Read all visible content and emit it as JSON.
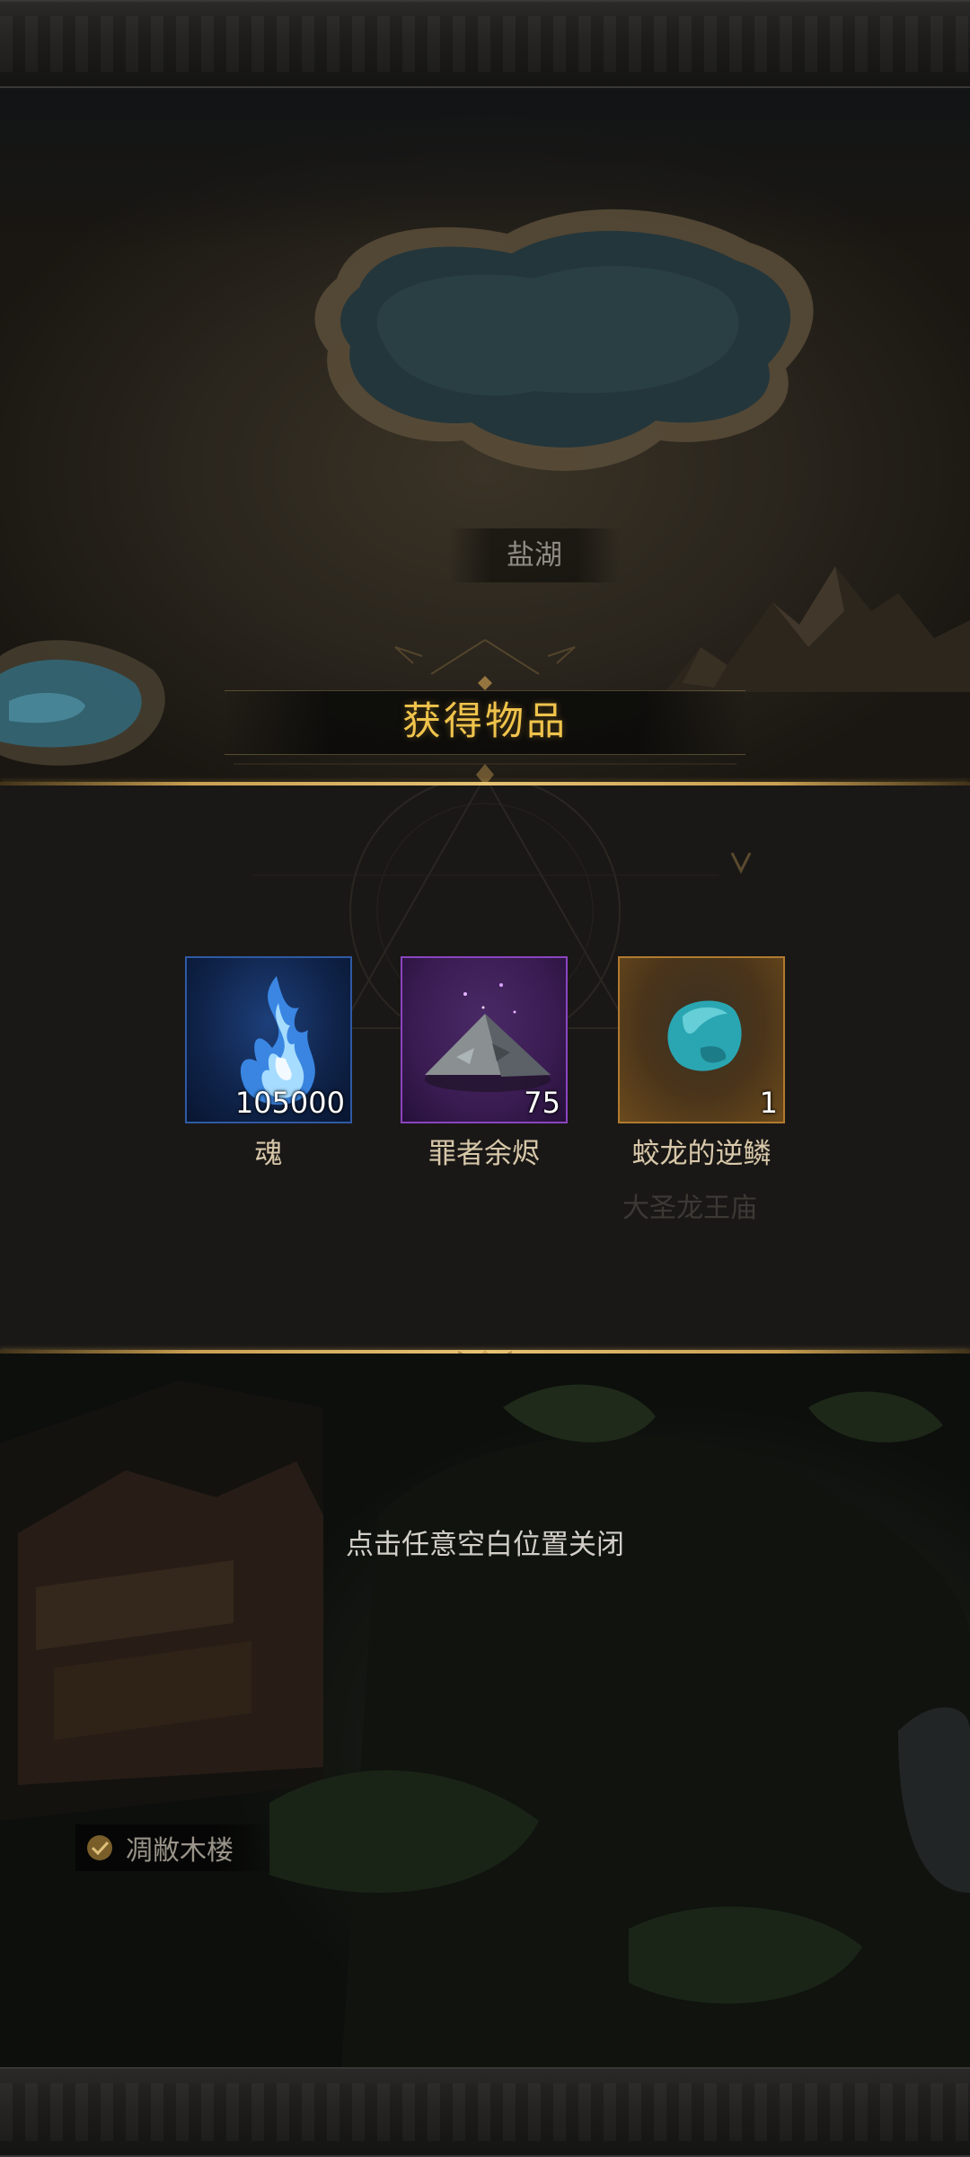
{
  "map": {
    "lake_label": "盐湖",
    "faded_location_label": "大圣龙王庙",
    "location_tag": "凋敝木楼"
  },
  "reward_popup": {
    "title": "获得物品",
    "items": [
      {
        "name": "魂",
        "quantity": "105000",
        "icon": "blue-soul-flame-icon",
        "rarity_color": "#2f5aa5"
      },
      {
        "name": "罪者余烬",
        "quantity": "75",
        "icon": "ash-pile-icon",
        "rarity_color": "#8a44c0"
      },
      {
        "name": "蛟龙的逆鳞",
        "quantity": "1",
        "icon": "teal-scale-stone-icon",
        "rarity_color": "#b07a2e"
      }
    ],
    "close_hint": "点击任意空白位置关闭"
  },
  "colors": {
    "title_gold": "#f0c44c",
    "divider_gold": "#e6c274"
  }
}
